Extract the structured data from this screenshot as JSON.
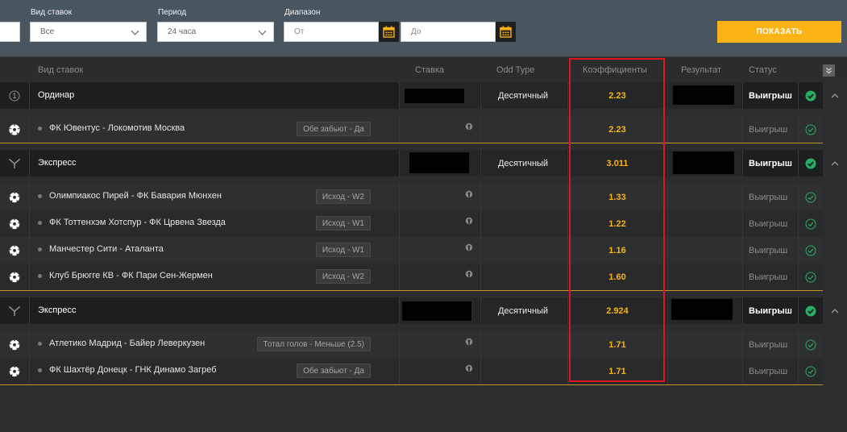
{
  "filters": {
    "bet_type": {
      "label": "Вид ставок",
      "value": "Все"
    },
    "period": {
      "label": "Период",
      "value": "24 часа"
    },
    "range": {
      "label": "Диапазон",
      "from_placeholder": "От",
      "to_placeholder": "До"
    },
    "show_button": "ПОКАЗАТЬ"
  },
  "columns": {
    "bet_type": "Вид ставок",
    "stake": "Ставка",
    "odd_type": "Odd Type",
    "coefficients": "Коэффициенты",
    "result": "Результат",
    "status": "Статус"
  },
  "groups": [
    {
      "icon": "single-bet-icon",
      "icon_text": "1",
      "name": "Ординар",
      "odd_type": "Десятичный",
      "coef": "2.23",
      "status": "Выигрыш",
      "legs": [
        {
          "match": "ФК Ювентус - Локомотив Москва",
          "market": "Обе забьют - Да",
          "coef": "2.23",
          "status": "Выигрыш"
        }
      ]
    },
    {
      "icon": "express-bet-icon",
      "name": "Экспресс",
      "odd_type": "Десятичный",
      "coef": "3.011",
      "status": "Выигрыш",
      "legs": [
        {
          "match": "Олимпиакос Пирей - ФК Бавария Мюнхен",
          "market": "Исход - W2",
          "coef": "1.33",
          "status": "Выигрыш"
        },
        {
          "match": "ФК Тоттенхэм Хотспур - ФК Црвена Звезда",
          "market": "Исход - W1",
          "coef": "1.22",
          "status": "Выигрыш"
        },
        {
          "match": "Манчестер Сити - Аталанта",
          "market": "Исход - W1",
          "coef": "1.16",
          "status": "Выигрыш"
        },
        {
          "match": "Клуб Брюгге КВ - ФК Пари Сен-Жермен",
          "market": "Исход - W2",
          "coef": "1.60",
          "status": "Выигрыш"
        }
      ]
    },
    {
      "icon": "express-bet-icon",
      "name": "Экспресс",
      "odd_type": "Десятичный",
      "coef": "2.924",
      "status": "Выигрыш",
      "legs": [
        {
          "match": "Атлетико Мадрид - Байер Леверкузен",
          "market": "Тотал голов - Меньше (2.5)",
          "coef": "1.71",
          "status": "Выигрыш"
        },
        {
          "match": "ФК Шахтёр Донецк - ГНК Динамо Загреб",
          "market": "Обе забьют - Да",
          "coef": "1.71",
          "status": "Выигрыш"
        }
      ]
    }
  ],
  "colors": {
    "accent": "#fcb316",
    "highlight_frame": "#e0161e",
    "win_check": "#27ae60"
  }
}
